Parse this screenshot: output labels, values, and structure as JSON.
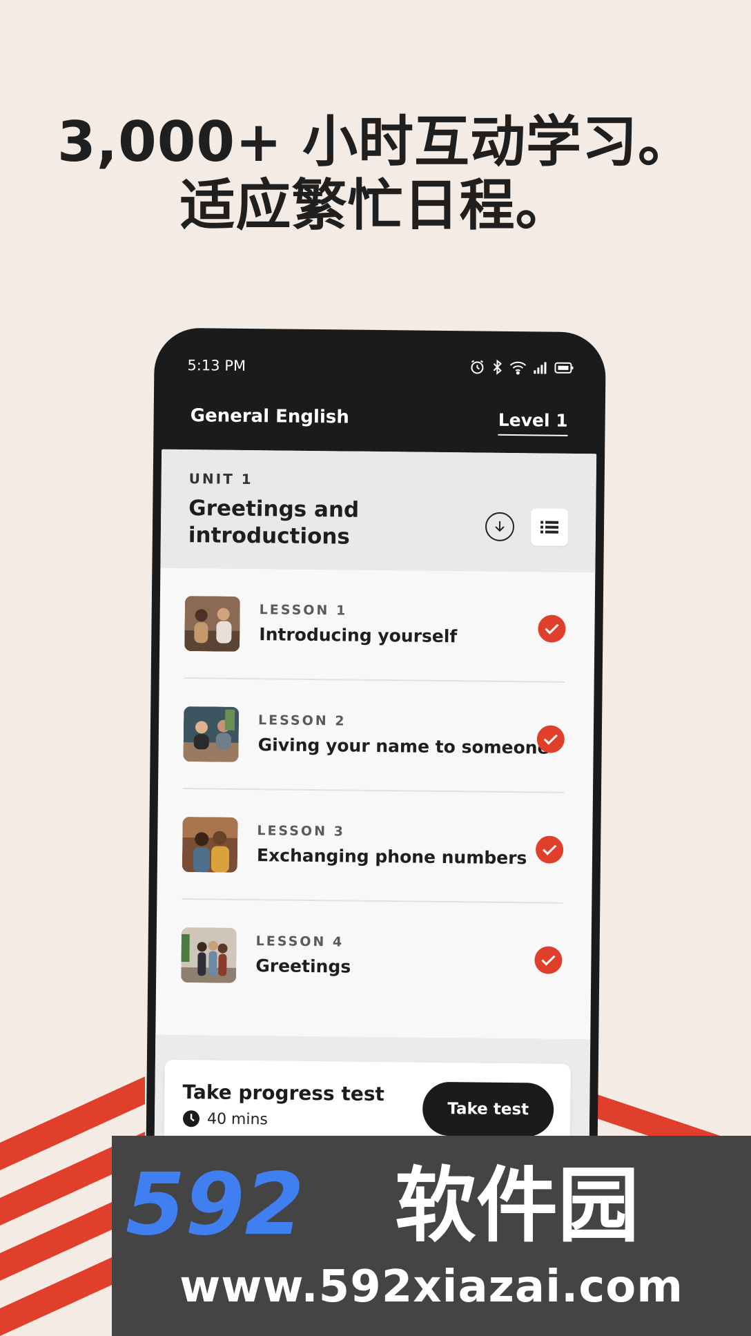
{
  "headline": {
    "line1": "3,000+ 小时互动学习。",
    "line2": "适应繁忙日程。"
  },
  "status_bar": {
    "time": "5:13 PM",
    "icons": [
      "alarm-icon",
      "bluetooth-icon",
      "wifi-icon",
      "signal-icon",
      "battery-icon"
    ]
  },
  "app_bar": {
    "course_title": "General English",
    "level_tab": "Level 1"
  },
  "unit": {
    "label": "UNIT 1",
    "title": "Greetings and introductions",
    "actions": [
      "download-icon",
      "list-icon"
    ]
  },
  "lessons": [
    {
      "number": "LESSON 1",
      "title": "Introducing yourself",
      "completed": true
    },
    {
      "number": "LESSON 2",
      "title": "Giving your name to someone",
      "completed": true
    },
    {
      "number": "LESSON 3",
      "title": "Exchanging phone numbers",
      "completed": true
    },
    {
      "number": "LESSON 4",
      "title": "Greetings",
      "completed": true
    }
  ],
  "progress_test": {
    "title": "Take progress test",
    "duration": "40 mins",
    "button_label": "Take test"
  },
  "watermark": {
    "brand": "592软件园",
    "url": "www.592xiazai.com"
  },
  "colors": {
    "background": "#f4ebe4",
    "accent_red": "#e0402b",
    "phone_frame": "#1b1b1b",
    "watermark_blue": "#3f7ff0"
  }
}
